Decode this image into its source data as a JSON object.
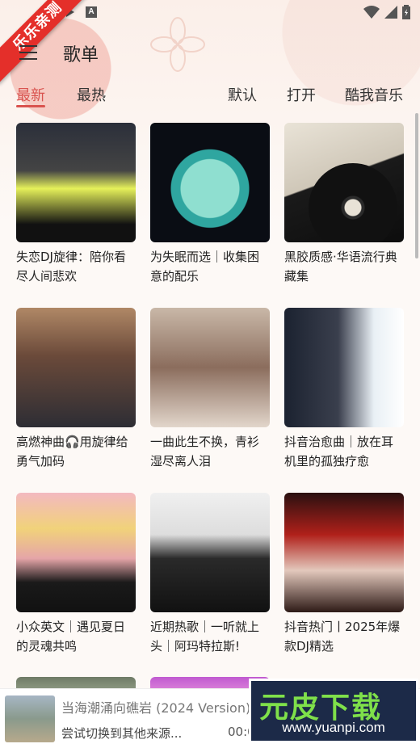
{
  "ribbon": {
    "label": "乐乐亲测"
  },
  "header": {
    "title": "歌单"
  },
  "tabs": [
    {
      "label": "最新",
      "active": true
    },
    {
      "label": "最热"
    },
    {
      "label": "默认"
    },
    {
      "label": "打开"
    },
    {
      "label": "酷我音乐"
    }
  ],
  "playlists": [
    {
      "title": "失恋DJ旋律：陪你看尽人间悲欢"
    },
    {
      "title": "为失眠而选｜收集困意的配乐"
    },
    {
      "title": "黑胶质感·华语流行典藏集"
    },
    {
      "title": "高燃神曲🎧用旋律给勇气加码"
    },
    {
      "title": "一曲此生不换，青衫湿尽离人泪"
    },
    {
      "title": "抖音治愈曲｜放在耳机里的孤独疗愈"
    },
    {
      "title": "小众英文｜遇见夏日的灵魂共鸣"
    },
    {
      "title": "近期热歌｜一听就上头｜阿玛特拉斯!"
    },
    {
      "title": "抖音热门丨2025年爆款DJ精选"
    }
  ],
  "player": {
    "song": "当海潮涌向礁岩 (2024 Version)",
    "status": "尝试切换到其他来源...",
    "time": "00:00"
  },
  "watermark": {
    "main": "元皮下载",
    "url": "www.yuanpi.com"
  },
  "colors": {
    "accent": "#d9534f",
    "ribbon": "#e42f2a"
  }
}
